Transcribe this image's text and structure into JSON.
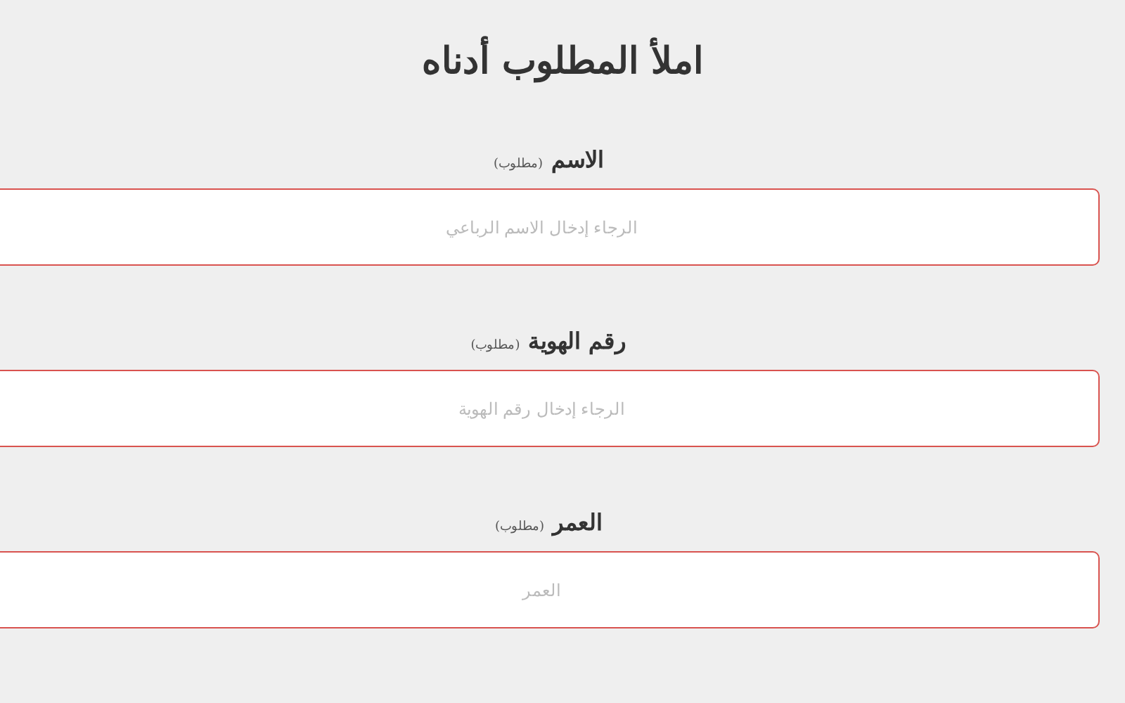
{
  "title": "املأ المطلوب أدناه",
  "fields": [
    {
      "label": "الاسم",
      "note": "(مطلوب)",
      "placeholder": "الرجاء إدخال الاسم الرباعي",
      "invalid": true
    },
    {
      "label": "رقم الهوية",
      "note": "(مطلوب)",
      "placeholder": "الرجاء إدخال رقم الهوية",
      "invalid": true
    },
    {
      "label": "العمر",
      "note": "(مطلوب)",
      "placeholder": "العمر",
      "invalid": true
    }
  ]
}
